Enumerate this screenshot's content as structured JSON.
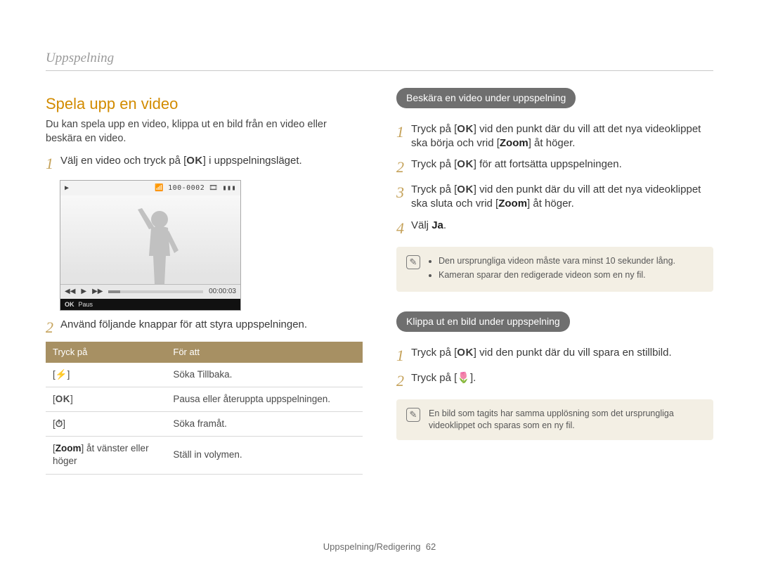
{
  "header": {
    "section": "Uppspelning"
  },
  "left": {
    "title": "Spela upp en video",
    "intro": "Du kan spela upp en video, klippa ut en bild från en video eller beskära en video.",
    "step1_pre": "Välj en video och tryck på [",
    "step1_post": "] i uppspelningsläget.",
    "screenshot": {
      "counter": "100-0002",
      "time": "00:00:03",
      "ok_label": "OK",
      "pause_label": "Paus"
    },
    "step2": "Använd följande knappar för att styra uppspelningen.",
    "table": {
      "head_press": "Tryck på",
      "head_for": "För att",
      "rows": [
        {
          "press_key": "flash",
          "action": "Söka Tillbaka."
        },
        {
          "press_key": "ok",
          "action": "Pausa eller återuppta uppspelningen."
        },
        {
          "press_key": "timer",
          "action": "Söka framåt."
        },
        {
          "press_key": "zoom",
          "press_text_pre": "[",
          "press_text_bold": "Zoom",
          "press_text_post": "] åt vänster eller höger",
          "action": "Ställ in volymen."
        }
      ]
    }
  },
  "right": {
    "section1_pill": "Beskära en video under uppspelning",
    "s1_step1_pre": "Tryck på [",
    "s1_step1_mid": "] vid den punkt där du vill att det nya videoklippet ska börja och vrid [",
    "s1_step1_zoom": "Zoom",
    "s1_step1_post": "] åt höger.",
    "s1_step2_pre": "Tryck på [",
    "s1_step2_post": "] för att fortsätta uppspelningen.",
    "s1_step3_pre": "Tryck på [",
    "s1_step3_mid": "] vid den punkt där du vill att det nya videoklippet ska sluta och vrid [",
    "s1_step3_zoom": "Zoom",
    "s1_step3_post": "] åt höger.",
    "s1_step4_pre": "Välj ",
    "s1_step4_bold": "Ja",
    "s1_step4_post": ".",
    "note1_a": "Den ursprungliga videon måste vara minst 10 sekunder lång.",
    "note1_b": "Kameran sparar den redigerade videon som en ny fil.",
    "section2_pill": "Klippa ut en bild under uppspelning",
    "s2_step1_pre": "Tryck på [",
    "s2_step1_post": "] vid den punkt där du vill spara en stillbild.",
    "s2_step2_pre": "Tryck på [",
    "s2_step2_post": "].",
    "note2": "En bild som tagits har samma upplösning som det ursprungliga videoklippet och sparas som en ny fil."
  },
  "footer": {
    "label": "Uppspelning/Redigering",
    "page": "62"
  }
}
